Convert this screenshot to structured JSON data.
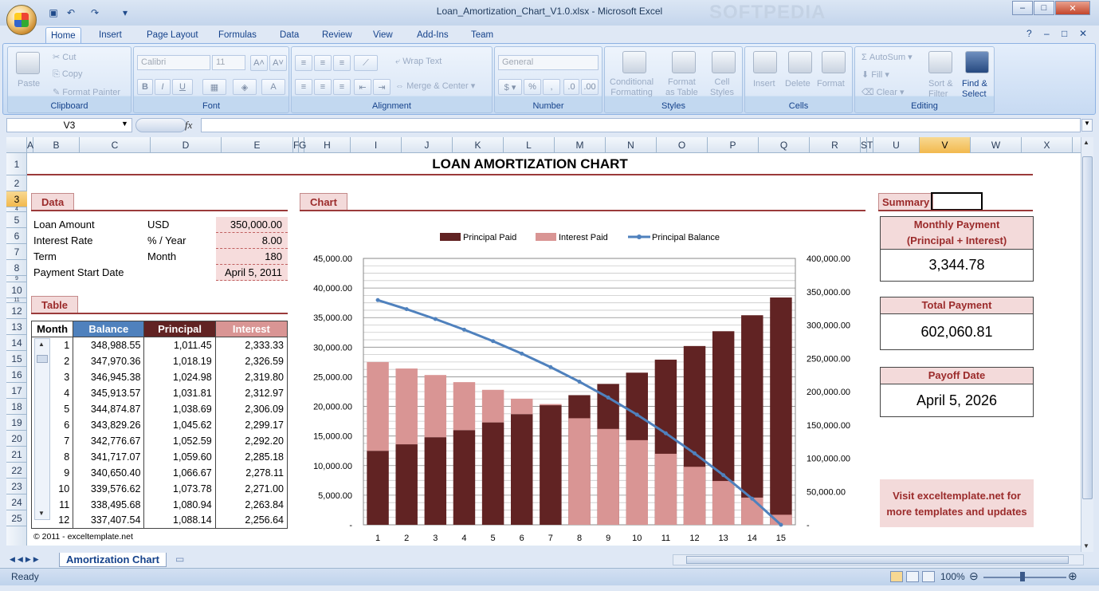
{
  "window": {
    "title": "Loan_Amortization_Chart_V1.0.xlsx - Microsoft Excel",
    "watermark": "SOFTPEDIA"
  },
  "ribbon_tabs": [
    "Home",
    "Insert",
    "Page Layout",
    "Formulas",
    "Data",
    "Review",
    "View",
    "Add-Ins",
    "Team"
  ],
  "ribbon": {
    "clipboard": {
      "label": "Clipboard",
      "paste": "Paste",
      "cut": "Cut",
      "copy": "Copy",
      "format_painter": "Format Painter"
    },
    "font": {
      "label": "Font",
      "name": "Calibri",
      "size": "11"
    },
    "alignment": {
      "label": "Alignment",
      "wrap": "Wrap Text",
      "merge": "Merge & Center"
    },
    "number": {
      "label": "Number",
      "format": "General"
    },
    "styles": {
      "label": "Styles",
      "conditional": "Conditional\nFormatting",
      "format_table": "Format\nas Table",
      "cell_styles": "Cell\nStyles"
    },
    "cells": {
      "label": "Cells",
      "insert": "Insert",
      "delete": "Delete",
      "format": "Format"
    },
    "editing": {
      "label": "Editing",
      "autosum": "AutoSum",
      "fill": "Fill",
      "clear": "Clear",
      "sort": "Sort &\nFilter",
      "find": "Find &\nSelect"
    }
  },
  "formula_bar": {
    "name_box": "V3",
    "fx": "fx",
    "value": ""
  },
  "columns": [
    "A",
    "B",
    "C",
    "D",
    "E",
    "F",
    "G",
    "H",
    "I",
    "J",
    "K",
    "L",
    "M",
    "N",
    "O",
    "P",
    "Q",
    "R",
    "S",
    "T",
    "U",
    "V",
    "W",
    "X"
  ],
  "selected_col": "V",
  "rows": [
    "1",
    "2",
    "3",
    "4",
    "5",
    "6",
    "7",
    "8",
    "9",
    "10",
    "11",
    "12",
    "13",
    "14",
    "15",
    "16",
    "17",
    "18",
    "19",
    "20",
    "21",
    "22",
    "23",
    "24",
    "25"
  ],
  "selected_row": "3",
  "sheet": {
    "title": "LOAN AMORTIZATION CHART",
    "data_tab": "Data",
    "chart_tab": "Chart",
    "table_tab": "Table",
    "summary_tab": "Summary",
    "inputs": [
      {
        "label": "Loan Amount",
        "unit": "USD",
        "value": "350,000.00"
      },
      {
        "label": "Interest Rate",
        "unit": "% / Year",
        "value": "8.00"
      },
      {
        "label": "Term",
        "unit": "Month",
        "value": "180"
      },
      {
        "label": "Payment Start Date",
        "unit": "",
        "value": "April 5, 2011"
      }
    ],
    "table_headers": [
      "Month",
      "Balance",
      "Principal",
      "Interest"
    ],
    "table_rows": [
      [
        "1",
        "348,988.55",
        "1,011.45",
        "2,333.33"
      ],
      [
        "2",
        "347,970.36",
        "1,018.19",
        "2,326.59"
      ],
      [
        "3",
        "346,945.38",
        "1,024.98",
        "2,319.80"
      ],
      [
        "4",
        "345,913.57",
        "1,031.81",
        "2,312.97"
      ],
      [
        "5",
        "344,874.87",
        "1,038.69",
        "2,306.09"
      ],
      [
        "6",
        "343,829.26",
        "1,045.62",
        "2,299.17"
      ],
      [
        "7",
        "342,776.67",
        "1,052.59",
        "2,292.20"
      ],
      [
        "8",
        "341,717.07",
        "1,059.60",
        "2,285.18"
      ],
      [
        "9",
        "340,650.40",
        "1,066.67",
        "2,278.11"
      ],
      [
        "10",
        "339,576.62",
        "1,073.78",
        "2,271.00"
      ],
      [
        "11",
        "338,495.68",
        "1,080.94",
        "2,263.84"
      ],
      [
        "12",
        "337,407.54",
        "1,088.14",
        "2,256.64"
      ]
    ],
    "copyright": "© 2011 - exceltemplate.net",
    "summary": [
      {
        "head": "Monthly Payment\n(Principal + Interest)",
        "value": "3,344.78"
      },
      {
        "head": "Total Payment",
        "value": "602,060.81"
      },
      {
        "head": "Payoff Date",
        "value": "April 5, 2026"
      }
    ],
    "promo": "Visit exceltemplate.net for\nmore templates and updates"
  },
  "chart_data": {
    "type": "bar",
    "stacked": true,
    "categories": [
      "1",
      "2",
      "3",
      "4",
      "5",
      "6",
      "7",
      "8",
      "9",
      "10",
      "11",
      "12",
      "13",
      "14",
      "15"
    ],
    "series": [
      {
        "name": "Principal Paid",
        "kind": "bar",
        "color": "#612323",
        "values": [
          12500,
          13600,
          14800,
          16000,
          17300,
          18700,
          20200,
          21900,
          23800,
          25700,
          27900,
          30200,
          32700,
          35400,
          38400
        ]
      },
      {
        "name": "Interest Paid",
        "kind": "bar",
        "color": "#d99594",
        "values": [
          15000,
          12800,
          10500,
          8100,
          5500,
          2600,
          200,
          18000,
          16200,
          14300,
          12000,
          9800,
          7400,
          4600,
          1700
        ]
      },
      {
        "name": "Principal Balance",
        "kind": "line",
        "axis": "right",
        "color": "#4f81bd",
        "values": [
          337400,
          323800,
          309000,
          293000,
          275700,
          257000,
          236800,
          214900,
          191100,
          165400,
          137500,
          107300,
          74600,
          39200,
          0
        ]
      }
    ],
    "y_left": {
      "min": 0,
      "max": 45000,
      "ticks": [
        "-",
        "5,000.00",
        "10,000.00",
        "15,000.00",
        "20,000.00",
        "25,000.00",
        "30,000.00",
        "35,000.00",
        "40,000.00",
        "45,000.00"
      ]
    },
    "y_right": {
      "min": 0,
      "max": 400000,
      "ticks": [
        "-",
        "50,000.00",
        "100,000.00",
        "150,000.00",
        "200,000.00",
        "250,000.00",
        "300,000.00",
        "350,000.00",
        "400,000.00"
      ]
    },
    "legend": "top",
    "grid": true
  },
  "sheet_tab": "Amortization Chart",
  "status": {
    "ready": "Ready",
    "zoom": "100%"
  }
}
